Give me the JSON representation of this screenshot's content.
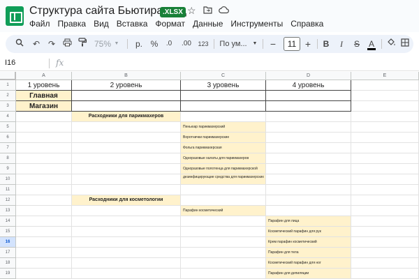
{
  "app": {
    "doc_title": "Структура сайта Бьютирасход",
    "badge": ".XLSX",
    "title_icons": [
      "star-icon",
      "move-to-folder-icon",
      "cloud-status-icon"
    ]
  },
  "menu": [
    "Файл",
    "Правка",
    "Вид",
    "Вставка",
    "Формат",
    "Данные",
    "Инструменты",
    "Справка"
  ],
  "toolbar": {
    "zoom": "75%",
    "currency": "р.",
    "percent": "%",
    "decrease_decimals": ".0",
    "increase_decimals": ".00",
    "number_format": "123",
    "font_name": "По ум...",
    "font_size": "11",
    "minus": "−",
    "plus": "+",
    "bold": "B",
    "italic": "I",
    "strike": "S",
    "text_color": "A"
  },
  "formula_bar": {
    "name_box": "I16",
    "fx": "fx",
    "value": ""
  },
  "grid": {
    "columns": [
      "A",
      "B",
      "C",
      "D",
      "E"
    ],
    "selected_row": "16",
    "rows": [
      {
        "n": "1",
        "a": "1 уровень",
        "b": "2 уровень",
        "c": "3 уровень",
        "d": "4 уровень"
      },
      {
        "n": "2",
        "a": "Главная",
        "b": "",
        "c": "",
        "d": ""
      },
      {
        "n": "3",
        "a": "Магазин",
        "b": "",
        "c": "",
        "d": ""
      },
      {
        "n": "4",
        "a": "",
        "b": "Расходники для парикмахеров",
        "c": "",
        "d": ""
      },
      {
        "n": "5",
        "a": "",
        "b": "",
        "c": "Пеньюар парикмахерский",
        "d": ""
      },
      {
        "n": "6",
        "a": "",
        "b": "",
        "c": "Воротнички парикмахерские",
        "d": ""
      },
      {
        "n": "7",
        "a": "",
        "b": "",
        "c": "Фольга парикмахерская",
        "d": ""
      },
      {
        "n": "8",
        "a": "",
        "b": "",
        "c": "Одноразовые халаты для парикмахеров",
        "d": ""
      },
      {
        "n": "9",
        "a": "",
        "b": "",
        "c": "Одноразовые полотенца для парикмахерской",
        "d": ""
      },
      {
        "n": "10",
        "a": "",
        "b": "",
        "c": "дезинфицирующие средства для парикмахерских",
        "d": ""
      },
      {
        "n": "11",
        "a": "",
        "b": "",
        "c": "",
        "d": ""
      },
      {
        "n": "12",
        "a": "",
        "b": "Расходники для косметологии",
        "c": "",
        "d": ""
      },
      {
        "n": "13",
        "a": "",
        "b": "",
        "c": "Парафин косметический",
        "d": ""
      },
      {
        "n": "14",
        "a": "",
        "b": "",
        "c": "",
        "d": "Парафин для лица"
      },
      {
        "n": "15",
        "a": "",
        "b": "",
        "c": "",
        "d": "Косметический парафин для рук"
      },
      {
        "n": "16",
        "a": "",
        "b": "",
        "c": "",
        "d": "Крем парафин косметический"
      },
      {
        "n": "17",
        "a": "",
        "b": "",
        "c": "",
        "d": "Парафин для тела"
      },
      {
        "n": "18",
        "a": "",
        "b": "",
        "c": "",
        "d": "Косметический парафин для ног"
      },
      {
        "n": "19",
        "a": "",
        "b": "",
        "c": "",
        "d": "Парафин для депиляции"
      }
    ]
  },
  "colors": {
    "highlight": "#fff2cc",
    "xlsx_badge": "#188038",
    "sheets_green": "#0f9d58",
    "selected_row": "#d3e3fd"
  }
}
